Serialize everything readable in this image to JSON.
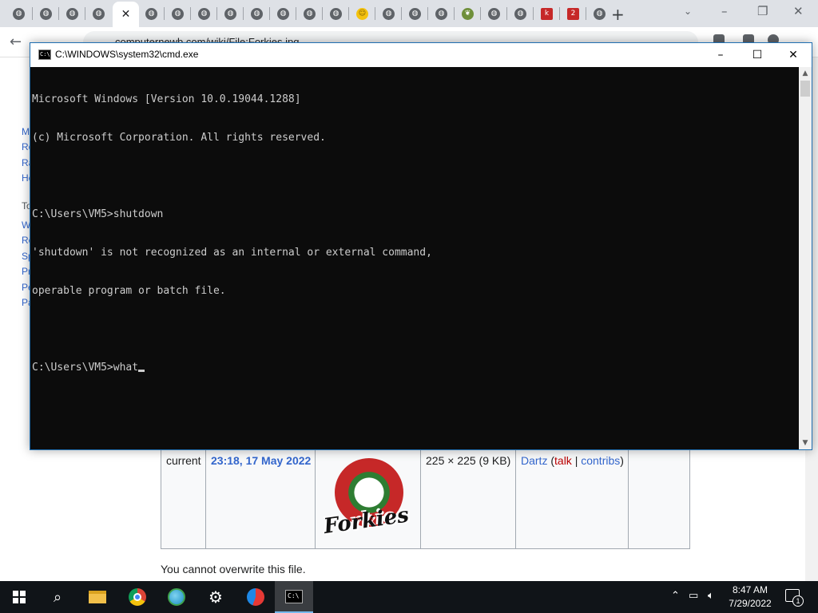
{
  "browser": {
    "tab_icons": [
      "globe-icon",
      "globe-icon",
      "globe-icon",
      "globe-icon",
      "close-icon",
      "globe-icon",
      "globe-icon",
      "globe-icon",
      "globe-icon",
      "globe-icon",
      "globe-icon",
      "globe-icon",
      "globe-icon",
      "smiley-icon",
      "globe-icon",
      "globe-icon",
      "globe-icon",
      "leaf-icon",
      "globe-icon",
      "globe-icon",
      "k-icon",
      "2-icon",
      "globe-icon"
    ],
    "tab_k_label": "k",
    "tab_2_label": "2",
    "new_tab_glyph": "+",
    "url": "computernewb.com/wiki/File:Forkies.jpg"
  },
  "wiki": {
    "sidebar_fragments": [
      "M",
      "Re",
      "Ra",
      "He"
    ],
    "tools_fragment": "To",
    "tools_fragments": [
      "W",
      "Re",
      "Sp",
      "Pr",
      "Pe",
      "Pa"
    ],
    "history_row": {
      "status": "current",
      "datetime": "23:18, 17 May 2022",
      "dimensions": "225 × 225 (9 KB)",
      "user": "Dartz",
      "talk": "talk",
      "contribs": "contribs",
      "thumb_text": "Forkies"
    },
    "overwrite_notice": "You cannot overwrite this file."
  },
  "cmd": {
    "title": "C:\\WINDOWS\\system32\\cmd.exe",
    "lines": [
      "Microsoft Windows [Version 10.0.19044.1288]",
      "(c) Microsoft Corporation. All rights reserved.",
      "",
      "C:\\Users\\VM5>shutdown",
      "'shutdown' is not recognized as an internal or external command,",
      "operable program or batch file.",
      ""
    ],
    "prompt": "C:\\Users\\VM5>",
    "typed": "what",
    "text_color": "#cccccc",
    "background_color": "#0c0c0c"
  },
  "taskbar": {
    "apps": [
      "windows-start-icon",
      "search-icon",
      "file-explorer-icon",
      "chrome-icon",
      "network-globe-icon",
      "settings-gear-icon",
      "ccleaner-icon",
      "cmd-icon"
    ],
    "active_app": "cmd-icon",
    "time": "8:47 AM",
    "date": "7/29/2022",
    "notification_count": "1"
  }
}
